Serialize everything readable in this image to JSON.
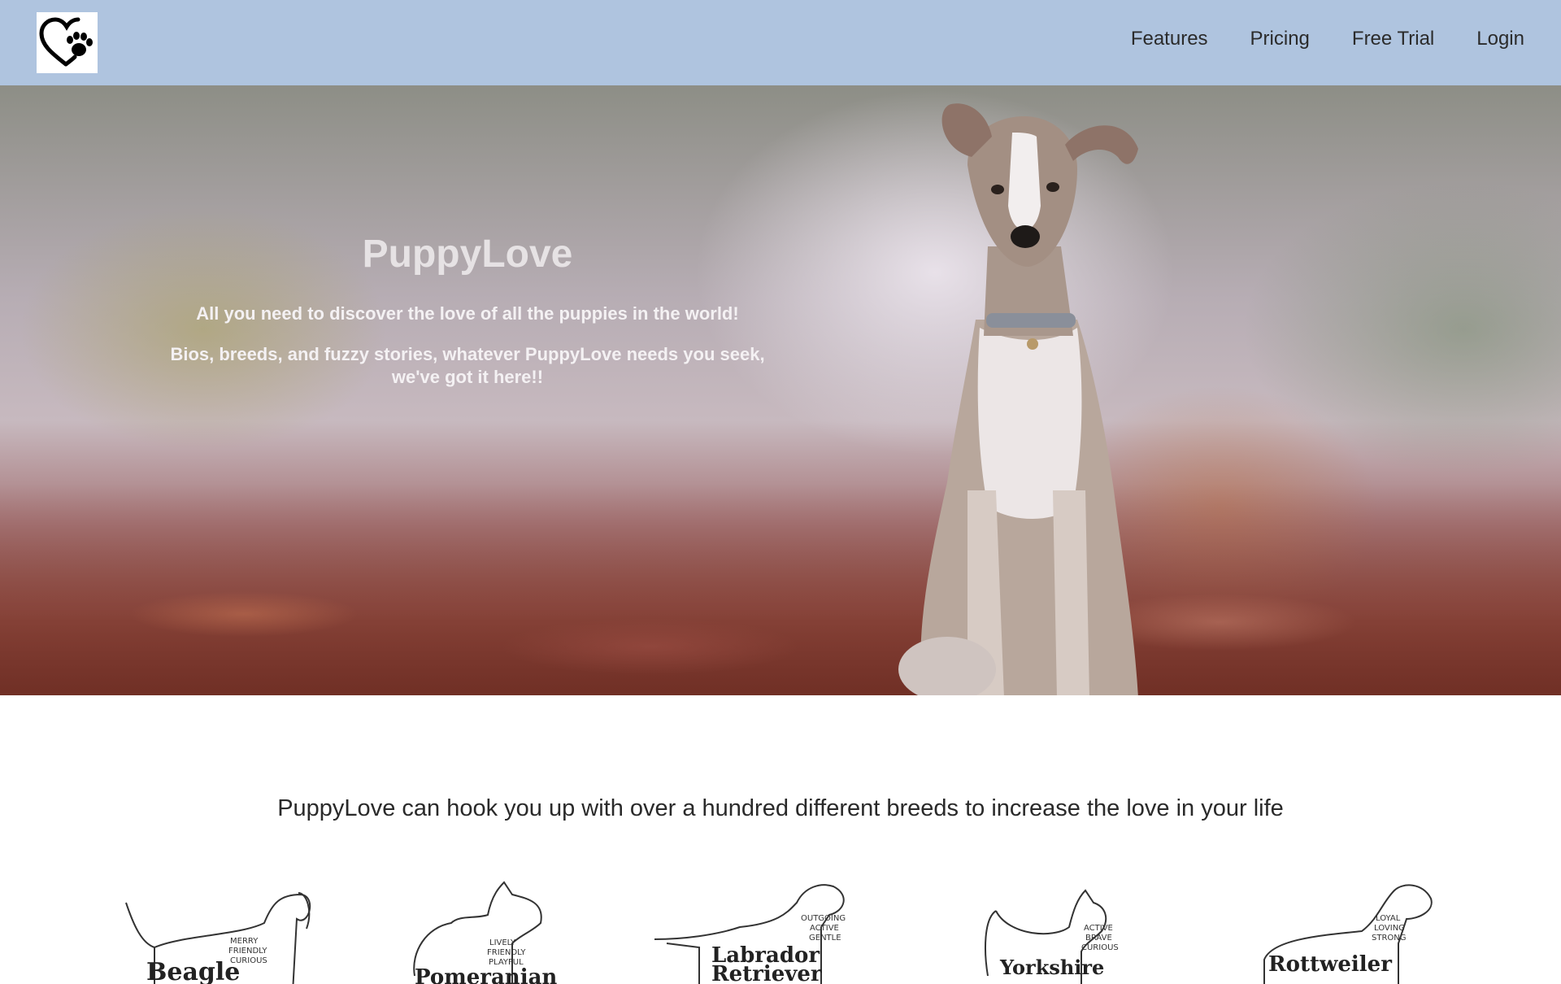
{
  "nav": {
    "logo_icon": "heart-paw-icon",
    "links": [
      "Features",
      "Pricing",
      "Free Trial",
      "Login"
    ]
  },
  "hero": {
    "title": "PuppyLove",
    "line1": "All you need to discover the love of all the puppies in the world!",
    "line2": "Bios, breeds, and fuzzy stories, whatever PuppyLove needs you seek, we've got it here!!"
  },
  "breeds": {
    "heading": "PuppyLove can hook you up with over a hundred different breeds to increase the love in your life",
    "items": [
      {
        "name": "Beagle",
        "traits": [
          "MERRY",
          "FRIENDLY",
          "CURIOUS"
        ]
      },
      {
        "name": "Pomeranian",
        "traits": [
          "LIVELY",
          "FRIENDLY",
          "PLAYFUL"
        ]
      },
      {
        "name": "Labrador Retriever",
        "name_lines": [
          "Labrador",
          "Retriever"
        ],
        "traits": [
          "OUTGOING",
          "ACTIVE",
          "GENTLE"
        ]
      },
      {
        "name": "Yorkshire",
        "traits": [
          "ACTIVE",
          "BRAVE",
          "CURIOUS"
        ]
      },
      {
        "name": "Rottweiler",
        "traits": [
          "LOYAL",
          "LOVING",
          "STRONG"
        ]
      }
    ]
  }
}
